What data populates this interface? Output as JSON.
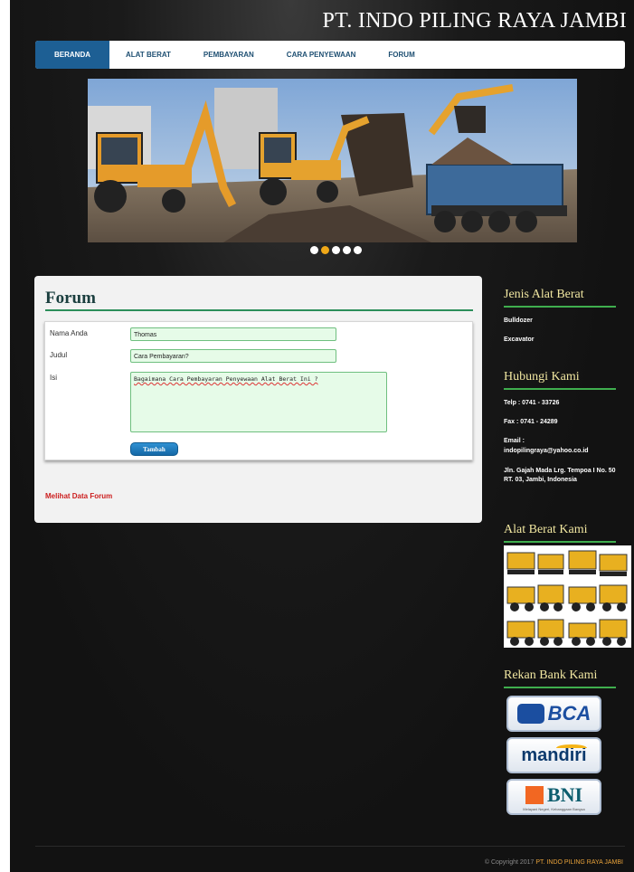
{
  "site": {
    "title": "PT. INDO PILING RAYA JAMBI"
  },
  "nav": {
    "items": [
      {
        "label": "BERANDA",
        "active": true
      },
      {
        "label": "ALAT BERAT",
        "active": false
      },
      {
        "label": "PEMBAYARAN",
        "active": false
      },
      {
        "label": "CARA PENYEWAAN",
        "active": false
      },
      {
        "label": "FORUM",
        "active": false
      }
    ]
  },
  "slider": {
    "dot_count": 5,
    "active_index": 1
  },
  "forum": {
    "title": "Forum",
    "fields": {
      "name_label": "Nama Anda",
      "name_value": "Thomas",
      "subject_label": "Judul",
      "subject_value": "Cara Pembayaran?",
      "body_label": "Isi",
      "body_value": "Bagaimana Cara Pembayaran Penyewaan Alat Berat Ini ?"
    },
    "submit_label": "Tambah",
    "view_link": "Melihat Data Forum"
  },
  "sidebar": {
    "equipment": {
      "heading": "Jenis Alat Berat",
      "items": [
        "Bulldozer",
        "Excavator"
      ]
    },
    "contact": {
      "heading": "Hubungi Kami",
      "phone": "Telp : 0741 - 33726",
      "fax": "Fax : 0741 - 24289",
      "email_label": "Email :",
      "email": "indopilingraya@yahoo.co.id",
      "address": "Jln. Gajah Mada Lrg. Tempoa I No. 50 RT. 03, Jambi, Indonesia"
    },
    "gallery": {
      "heading": "Alat Berat Kami"
    },
    "banks": {
      "heading": "Rekan Bank Kami",
      "items": [
        "BCA",
        "mandiri",
        "BNI"
      ],
      "bni_tagline": "Melayani Negeri, Kebanggaan Bangsa"
    }
  },
  "footer": {
    "copyright_prefix": "© Copyright 2017",
    "brand": "PT. INDO PILING RAYA JAMBI"
  },
  "colors": {
    "nav_active": "#1d5f94",
    "accent_green": "#2c8f5a",
    "sidebar_heading": "#f0e6a0",
    "link_red": "#cc1e1e",
    "slider_active": "#f0a818"
  }
}
